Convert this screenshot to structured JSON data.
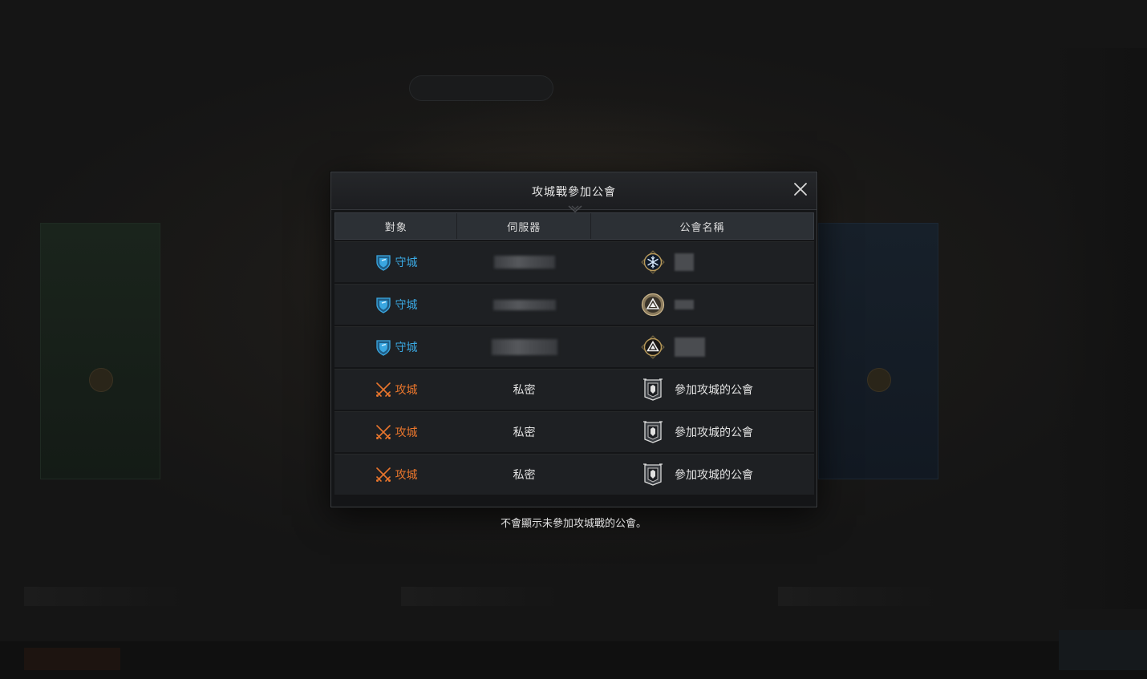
{
  "dialog": {
    "title": "攻城戰參加公會"
  },
  "table": {
    "headers": [
      "對象",
      "伺服器",
      "公會名稱"
    ],
    "rows": [
      {
        "target": "守城",
        "side": "defense",
        "server": "",
        "server_hidden": true,
        "guild": "",
        "guild_hidden": true,
        "emblem": "snowflake-emblem-icon"
      },
      {
        "target": "守城",
        "side": "defense",
        "server": "",
        "server_hidden": true,
        "guild": "",
        "guild_hidden": true,
        "emblem": "triangle-emblem-icon"
      },
      {
        "target": "守城",
        "side": "defense",
        "server": "",
        "server_hidden": true,
        "guild": "",
        "guild_hidden": true,
        "emblem": "triangle-emblem-icon"
      },
      {
        "target": "攻城",
        "side": "attack",
        "server": "私密",
        "server_hidden": false,
        "guild": "參加攻城的公會",
        "guild_hidden": false,
        "emblem": "banner-emblem-icon"
      },
      {
        "target": "攻城",
        "side": "attack",
        "server": "私密",
        "server_hidden": false,
        "guild": "參加攻城的公會",
        "guild_hidden": false,
        "emblem": "banner-emblem-icon"
      },
      {
        "target": "攻城",
        "side": "attack",
        "server": "私密",
        "server_hidden": false,
        "guild": "參加攻城的公會",
        "guild_hidden": false,
        "emblem": "banner-emblem-icon"
      }
    ]
  },
  "footnote": "不會顯示未參加攻城戰的公會。",
  "colors": {
    "defense": "#3aa7e0",
    "attack": "#e8752c"
  }
}
